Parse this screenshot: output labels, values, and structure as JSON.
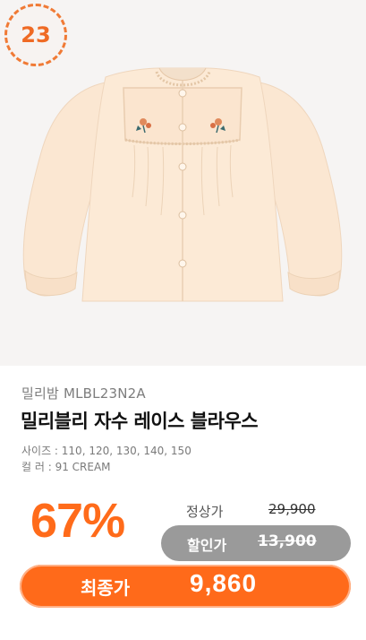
{
  "rank_badge": {
    "number": "23"
  },
  "product": {
    "brand_line": "밀리밤 MLBL23N2A",
    "title": "밀리블리 자수 레이스 블라우스",
    "sizes_line": "사이즈 : 110, 120, 130, 140, 150",
    "color_line": "컬    러 : 91 CREAM"
  },
  "pricing": {
    "discount_rate": "67%",
    "regular_label": "정상가",
    "regular_price": "29,900",
    "sale_label": "할인가",
    "sale_price": "13,900",
    "final_label": "최종가",
    "final_price": "9,860"
  },
  "colors": {
    "accent": "#ff6a1a",
    "badge_orange": "#ef6a24",
    "sale_pill_gray": "#9a9a9a",
    "image_background": "#f6f4f3",
    "garment_cream": "#fbe8d3"
  },
  "icons": {
    "product_image": "cream-embroidered-lace-blouse-image"
  }
}
